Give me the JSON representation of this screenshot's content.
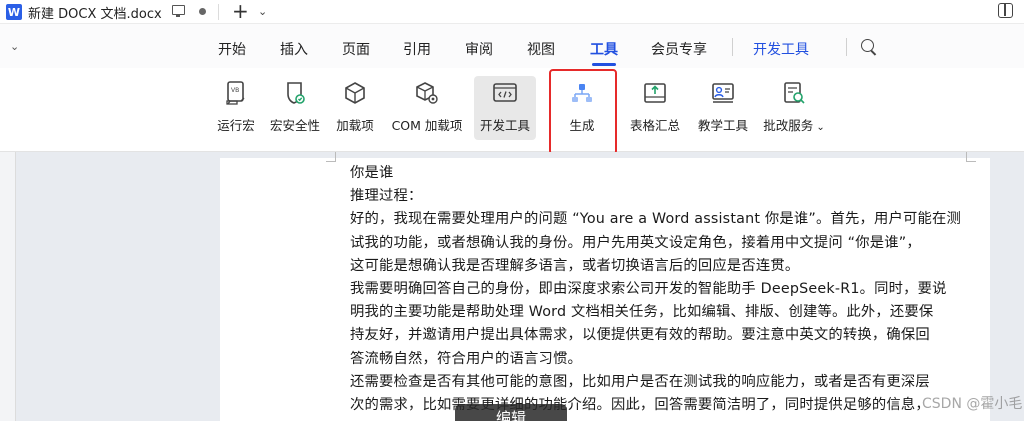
{
  "window": {
    "doc_title": "新建 DOCX 文档.docx",
    "logo_letter": "W"
  },
  "menu": {
    "items": [
      "开始",
      "插入",
      "页面",
      "引用",
      "审阅",
      "视图",
      "工具",
      "会员专享",
      "开发工具"
    ],
    "active": "工具",
    "accent": "#2250e0"
  },
  "ribbon": {
    "buttons": [
      {
        "label": "运行宏",
        "icon": "run-macro-icon"
      },
      {
        "label": "宏安全性",
        "icon": "macro-security-icon"
      },
      {
        "label": "加载项",
        "icon": "addin-cube-icon"
      },
      {
        "label": "COM 加载项",
        "icon": "com-addin-icon"
      },
      {
        "label": "开发工具",
        "icon": "developer-code-icon"
      },
      {
        "label": "生成",
        "icon": "generate-flow-icon"
      },
      {
        "label": "表格汇总",
        "icon": "table-summary-icon"
      },
      {
        "label": "教学工具",
        "icon": "teaching-tools-icon"
      },
      {
        "label": "批改服务",
        "icon": "grading-service-icon"
      }
    ],
    "highlight_color": "#e62a2a"
  },
  "document": {
    "lines": [
      "你是谁",
      "推理过程：",
      "好的，我现在需要处理用户的问题 “You are a Word assistant 你是谁”。首先，用户可能在测",
      "试我的功能，或者想确认我的身份。用户先用英文设定角色，接着用中文提问 “你是谁”，",
      "这可能是想确认我是否理解多语言，或者切换语言后的回应是否连贯。",
      "我需要明确回答自己的身份，即由深度求索公司开发的智能助手 DeepSeek-R1。同时，要说",
      "明我的主要功能是帮助处理 Word 文档相关任务，比如编辑、排版、创建等。此外，还要保",
      "持友好，并邀请用户提出具体需求，以便提供更有效的帮助。要注意中英文的转换，确保回",
      "答流畅自然，符合用户的语言习惯。",
      "还需要检查是否有其他可能的意图，比如用户是否在测试我的响应能力，或者是否有更深层",
      "次的需求，比如需要更详细的功能介绍。因此，回答需要简洁明了，同时提供足够的信息，"
    ]
  },
  "overlay": {
    "edit_label": "编辑",
    "watermark": "CSDN @霍小毛"
  }
}
